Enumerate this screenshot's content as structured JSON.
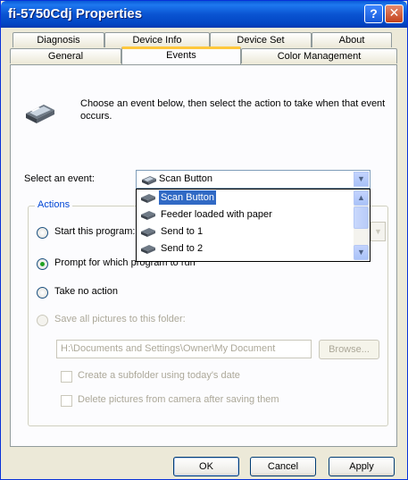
{
  "window": {
    "title": "fi-5750Cdj Properties",
    "help_label": "?",
    "close_label": "✕"
  },
  "tabs": {
    "row1": [
      "Diagnosis",
      "Device Info",
      "Device Set",
      "About"
    ],
    "row2": [
      "General",
      "Events",
      "Color Management"
    ],
    "active": "Events"
  },
  "intro": {
    "text": "Choose an event below, then select the action to take when that event occurs.",
    "icon": "scanner-icon"
  },
  "event_select": {
    "label": "Select an event:",
    "value": "Scan Button",
    "options": [
      "Scan Button",
      "Feeder loaded with paper",
      "Send to 1",
      "Send to 2"
    ],
    "selected_index": 0
  },
  "actions": {
    "legend": "Actions",
    "start_program_label": "Start this program:",
    "prompt_label": "Prompt for which program to run",
    "no_action_label": "Take no action",
    "selected": "prompt",
    "save_all_label": "Save all pictures to this folder:",
    "folder_path": "H:\\Documents and Settings\\Owner\\My Document",
    "browse_label": "Browse...",
    "subfolder_label": "Create a subfolder using today's date",
    "delete_label": "Delete pictures from camera after saving them"
  },
  "buttons": {
    "ok": "OK",
    "cancel": "Cancel",
    "apply": "Apply"
  },
  "colors": {
    "titlebar": "#0a54d2",
    "selection": "#316ac5",
    "active_tab_accent": "#ffc83c"
  }
}
